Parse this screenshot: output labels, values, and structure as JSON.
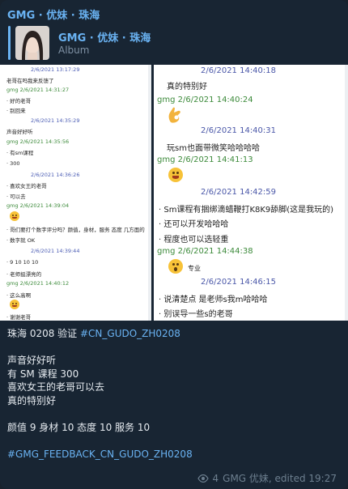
{
  "header": {
    "sender": "GMG · 优妹 · 珠海"
  },
  "reply": {
    "title": "GMG · 优妹 · 珠海",
    "subtitle": "Album"
  },
  "left_shot": {
    "rows": [
      {
        "kind": "ts",
        "text": "2/6/2021 13:17:29"
      },
      {
        "kind": "txt",
        "text": "老哥在吗我来反馈了"
      },
      {
        "kind": "name",
        "text": "gmg 2/6/2021 14:31:27"
      },
      {
        "kind": "txt",
        "text": "· 好的老哥"
      },
      {
        "kind": "txt",
        "text": "· 别回来"
      },
      {
        "kind": "ts",
        "text": "2/6/2021 14:35:29"
      },
      {
        "kind": "txt",
        "text": "声音好好听"
      },
      {
        "kind": "name",
        "text": "gmg 2/6/2021 14:35:56"
      },
      {
        "kind": "txt",
        "text": "· 有sm课程"
      },
      {
        "kind": "txt",
        "text": "· 300"
      },
      {
        "kind": "ts",
        "text": "2/6/2021 14:36:26"
      },
      {
        "kind": "txt",
        "text": "· 喜欢女王的老哥"
      },
      {
        "kind": "txt",
        "text": "· 可以去"
      },
      {
        "kind": "name",
        "text": "gmg 2/6/2021 14:39:04"
      },
      {
        "kind": "txt",
        "text": "· 哥们要打个数字评分吗？颜值，身材，服务 态度 几方面的"
      },
      {
        "kind": "txt",
        "text": "· 数字就 OK"
      },
      {
        "kind": "ts",
        "text": "2/6/2021 14:39:44"
      },
      {
        "kind": "txt",
        "text": "· 9 10 10 10"
      },
      {
        "kind": "txt",
        "text": "· 老师挺漂亮的"
      },
      {
        "kind": "name",
        "text": "gmg 2/6/2021 14:40:12"
      },
      {
        "kind": "txt",
        "text": "· 这么高啊"
      },
      {
        "kind": "txt",
        "text": "· 谢谢老哥"
      }
    ]
  },
  "right_shot": {
    "rows": [
      {
        "kind": "ts",
        "text": "2/6/2021 14:40:18"
      },
      {
        "kind": "txt",
        "text": "真的特别好"
      },
      {
        "kind": "name",
        "text": "gmg 2/6/2021 14:40:24"
      },
      {
        "kind": "ts",
        "text": "2/6/2021 14:40:31"
      },
      {
        "kind": "txt",
        "text": "玩sm也面带微笑哈哈哈哈"
      },
      {
        "kind": "name",
        "text": "gmg 2/6/2021 14:41:13"
      },
      {
        "kind": "ts",
        "text": "2/6/2021 14:42:59"
      },
      {
        "kind": "txt",
        "text": "· Sm课程有捆绑滴蜡鞭打K8K9舔脚(这是我玩的)"
      },
      {
        "kind": "txt",
        "text": "· 还可以开发哈哈哈"
      },
      {
        "kind": "txt",
        "text": "· 程度也可以选轻重"
      },
      {
        "kind": "name",
        "text": "gmg 2/6/2021 14:44:38"
      },
      {
        "kind": "txt",
        "text": "专业"
      },
      {
        "kind": "ts",
        "text": "2/6/2021 14:46:15"
      },
      {
        "kind": "txt",
        "text": "· 说清楚点 是老师s我m哈哈哈"
      },
      {
        "kind": "txt",
        "text": "· 别误导一些s的老哥"
      }
    ]
  },
  "caption": {
    "line1_text": "珠海 0208 验证 ",
    "line1_tag": "#CN_GUDO_ZH0208",
    "line2": "声音好好听",
    "line3": "有 SM 课程 300",
    "line4": "喜欢女王的老哥可以去",
    "line5": "真的特别好",
    "line6": "颜值 9 身材 10 态度 10 服务 10",
    "line7_tag": "#GMG_FEEDBACK_CN_GUDO_ZH0208"
  },
  "footer": {
    "views": "4",
    "meta": "GMG 优妹, edited 19:27",
    "icon": "eye-icon"
  },
  "colors": {
    "bubble": "#182533",
    "accent": "#6ab3f3",
    "muted": "#6d7f8f"
  }
}
